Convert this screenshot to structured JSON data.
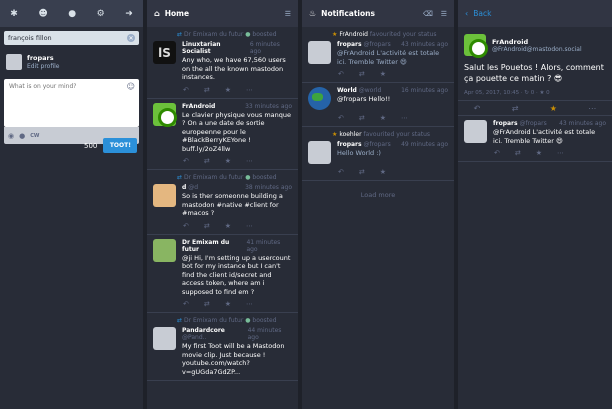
{
  "compose": {
    "nav_icons": [
      "asterisk-icon",
      "users-icon",
      "globe-icon",
      "gear-icon",
      "sign-out-icon"
    ],
    "search_value": "françois fillon",
    "account": {
      "name": "fropars",
      "edit_label": "Edit profile"
    },
    "placeholder": "What is on your mind?",
    "cw_label": "CW",
    "char_count": "500",
    "toot_label": "TOOT!"
  },
  "home": {
    "title": "Home",
    "statuses": [
      {
        "boosted_by": "Dr Emixam du futur",
        "boosted_label": "boosted",
        "name": "Linuxtarian Socialist",
        "time": "6 minutes ago",
        "text": "Any who, we have 67,560 users on the all the known mastodon instances.",
        "avatar": "ls"
      },
      {
        "name": "FrAndroid",
        "time": "33 minutes ago",
        "text": "Le clavier physique vous manque ? On a une date de sortie europeenne pour le #BlackBerryKEYone ! buff.ly/2oZ4llw",
        "avatar": "green"
      },
      {
        "boosted_by": "Dr Emixam du futur",
        "boosted_label": "boosted",
        "name": "d",
        "account": "@d",
        "time": "38 minutes ago",
        "text": "So is ther someonne building a mastodon #native #client for #macos ?",
        "avatar": "face"
      },
      {
        "name": "Dr Emixam du futur",
        "time": "41 minutes ago",
        "text": "@ji Hi, I'm setting up a usercount bot for my instance but I can't find the client id/secret and access token, where am i supposed to find em ?",
        "avatar": "face2"
      },
      {
        "boosted_by": "Dr Emixam du futur",
        "boosted_label": "boosted",
        "name": "Pandardcore",
        "account": "@Pand..",
        "time": "44 minutes ago",
        "text": "My first Toot will be a Mastodon movie clip. Just because ! youtube.com/watch?v=gUGda7GdZP...",
        "avatar": "blank"
      }
    ]
  },
  "notifications": {
    "title": "Notifications",
    "items": [
      {
        "actor": "FrAndroid",
        "action": "favourited your status",
        "name": "fropars",
        "account": "@fropars",
        "time": "43 minutes ago",
        "text": "@FrAndroid L'activité est totale ici. Tremble Twitter 😄",
        "avatar": "blank"
      },
      {
        "name": "World",
        "account": "@world",
        "time": "16 minutes ago",
        "text": "@fropars Hello!!",
        "avatar": "globe"
      },
      {
        "actor": "koehler",
        "action": "favourited your status",
        "name": "fropars",
        "account": "@fropars",
        "time": "49 minutes ago",
        "text": "Hello World :)",
        "avatar": "blank"
      }
    ],
    "load_more": "Load more"
  },
  "detail": {
    "back_label": "Back",
    "author": {
      "name": "FrAndroid",
      "account": "@FrAndroid@mastodon.social"
    },
    "text": "Salut les Pouetos ! Alors, comment ça pouette ce matin ? 😎",
    "meta": "Apr 05, 2017, 10:45 · ↻ 0 · ★ 0",
    "reply": {
      "name": "fropars",
      "account": "@fropars",
      "time": "43 minutes ago",
      "text": "@FrAndroid L'activité est totale ici. Tremble Twitter 😄"
    }
  }
}
